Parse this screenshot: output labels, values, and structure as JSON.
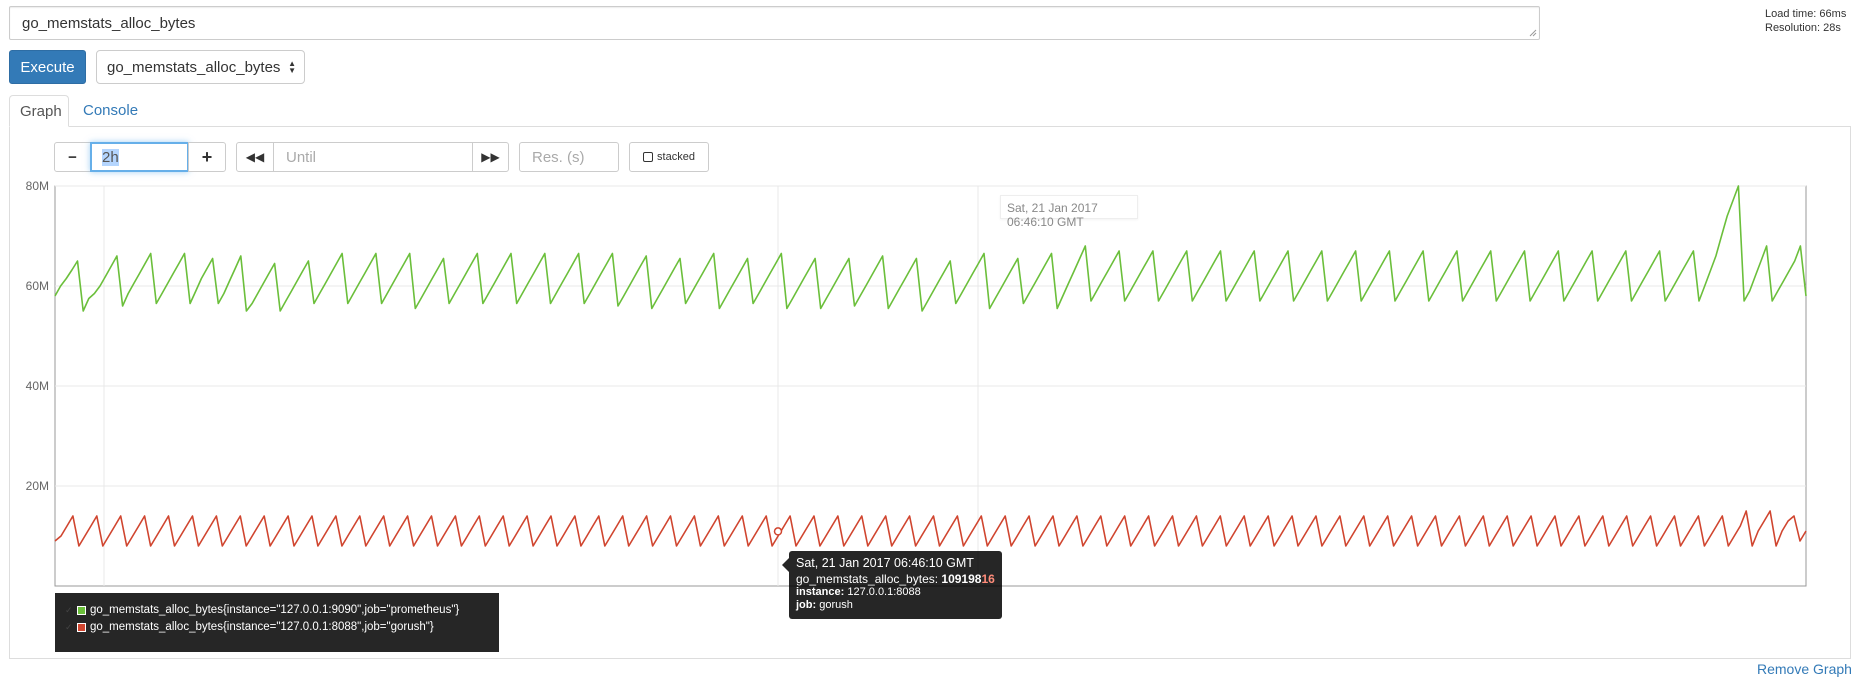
{
  "expression": {
    "value": "go_memstats_alloc_bytes"
  },
  "meta": {
    "load_time": "Load time: 66ms",
    "resolution": "Resolution: 28s"
  },
  "execute": {
    "label": "Execute"
  },
  "metric_select": {
    "selected": "go_memstats_alloc_bytes"
  },
  "tabs": [
    {
      "label": "Graph",
      "active": true
    },
    {
      "label": "Console",
      "active": false
    }
  ],
  "controls": {
    "minus": "−",
    "range": "2h",
    "plus": "+",
    "back": "◀◀",
    "until_placeholder": "Until",
    "forward": "▶▶",
    "res_placeholder": "Res. (s)",
    "stacked": "stacked"
  },
  "hover_time": "Sat, 21 Jan 2017 06:46:10 GMT",
  "tooltip": {
    "time": "Sat, 21 Jan 2017 06:46:10 GMT",
    "metric_label": "go_memstats_alloc_bytes: ",
    "value_main": "109198",
    "value_highlight": "16",
    "instance_label": "instance:",
    "instance_value": "127.0.0.1:8088",
    "job_label": "job:",
    "job_value": "gorush"
  },
  "legend": [
    {
      "label": "go_memstats_alloc_bytes{instance=\"127.0.0.1:9090\",job=\"prometheus\"}",
      "color": "#6bbf3b"
    },
    {
      "label": "go_memstats_alloc_bytes{instance=\"127.0.0.1:8088\",job=\"gorush\"}",
      "color": "#d0452f"
    }
  ],
  "remove_graph": "Remove Graph",
  "chart_data": {
    "type": "line",
    "ylim": [
      0,
      80000000
    ],
    "y_ticks": [
      "20M",
      "40M",
      "60M",
      "80M"
    ],
    "grid": true,
    "series": [
      {
        "name": "go_memstats_alloc_bytes{instance=\"127.0.0.1:9090\",job=\"prometheus\"}",
        "color": "#6bbf3b",
        "values": [
          58,
          60,
          61.5,
          63.2,
          65,
          55,
          57.5,
          58.5,
          60,
          62,
          64,
          66,
          56,
          58.5,
          60.5,
          62.5,
          64.5,
          66.5,
          56.5,
          58.5,
          60.5,
          62.5,
          64.5,
          66.5,
          56.5,
          59,
          61.5,
          63.5,
          65.5,
          56.5,
          58.5,
          61,
          63.5,
          66,
          55,
          56.5,
          58.5,
          60.5,
          62.5,
          64.5,
          55,
          57,
          59,
          61,
          63,
          65,
          56.5,
          58.5,
          60.5,
          62.5,
          64.5,
          66.5,
          56.5,
          58.5,
          60.5,
          62.5,
          64.5,
          66.5,
          56.5,
          58.5,
          60.5,
          62.5,
          64.5,
          66.5,
          55.5,
          57.5,
          59.5,
          61.5,
          63.5,
          65.5,
          56.5,
          58.5,
          60.5,
          62.5,
          64.5,
          66.5,
          56.5,
          58.5,
          60.5,
          62.5,
          64.5,
          66.5,
          56.5,
          58.5,
          60.5,
          62.5,
          64.5,
          66.5,
          56.5,
          58.5,
          60.5,
          62.5,
          64.5,
          66.5,
          56.5,
          58.5,
          60.5,
          62.5,
          64.5,
          66.5,
          56,
          58,
          60,
          62,
          64,
          66,
          55.5,
          57.5,
          59.5,
          61.5,
          63.5,
          65.5,
          56.5,
          58.5,
          60.5,
          62.5,
          64.5,
          66.5,
          55.5,
          57.5,
          59.5,
          61.5,
          63.5,
          65.5,
          56.5,
          58.5,
          60.5,
          62.5,
          64.5,
          66.5,
          55.5,
          57.5,
          59.5,
          61.5,
          63.5,
          65.5,
          55.5,
          57.5,
          59.5,
          61.5,
          63.5,
          65.5,
          56,
          58,
          60,
          62,
          64,
          66,
          55.5,
          57.5,
          59.5,
          61.5,
          63.5,
          65.5,
          55,
          57,
          59,
          61,
          63,
          65,
          56.5,
          58.5,
          60.5,
          62.5,
          64.5,
          66.5,
          55.5,
          57.5,
          59.5,
          61.5,
          63.5,
          65.5,
          56.5,
          58.5,
          60.5,
          62.5,
          64.5,
          66.5,
          55.5,
          58,
          60.5,
          63,
          65.5,
          68,
          57,
          59,
          61,
          63,
          65,
          67,
          57,
          59,
          61,
          63,
          65,
          67,
          57,
          59,
          61,
          63,
          65,
          67,
          57,
          59,
          61,
          63,
          65,
          67,
          57,
          59,
          61,
          63,
          65,
          67,
          57,
          59,
          61,
          63,
          65,
          67,
          57,
          59,
          61,
          63,
          65,
          67,
          57,
          59,
          61,
          63,
          65,
          67,
          57,
          59,
          61,
          63,
          65,
          67,
          57,
          59,
          61,
          63,
          65,
          67,
          57,
          59,
          61,
          63,
          65,
          67,
          57,
          59,
          61,
          63,
          65,
          67,
          57,
          59,
          61,
          63,
          65,
          67,
          57,
          59,
          61,
          63,
          65,
          67,
          57,
          59,
          61,
          63,
          65,
          67,
          57,
          59,
          61,
          63,
          65,
          67,
          57,
          59,
          61,
          63,
          65,
          67,
          57,
          59,
          61,
          63,
          65,
          67,
          57,
          60,
          63,
          66,
          70,
          74,
          77,
          80,
          57,
          59,
          62,
          65,
          68,
          57,
          59,
          61,
          63,
          65,
          68,
          58
        ]
      },
      {
        "name": "go_memstats_alloc_bytes{instance=\"127.0.0.1:8088\",job=\"gorush\"}",
        "color": "#d0452f",
        "values": [
          9,
          10,
          12,
          14,
          8,
          10,
          12,
          14,
          8,
          10,
          12,
          14,
          8,
          10,
          12,
          14,
          8,
          10,
          12,
          14,
          8,
          10,
          12,
          14,
          8,
          10,
          12,
          14,
          8,
          10,
          12,
          14,
          8,
          10,
          12,
          14,
          8,
          10,
          12,
          14,
          8,
          10,
          12,
          14,
          8,
          10,
          12,
          14,
          8,
          10,
          12,
          14,
          8,
          10,
          12,
          14,
          8,
          10,
          12,
          14,
          8,
          10,
          12,
          14,
          8,
          10,
          12,
          14,
          8,
          10,
          12,
          14,
          8,
          10,
          12,
          14,
          8,
          10,
          12,
          14,
          8,
          10,
          12,
          14,
          8,
          10,
          12,
          14,
          8,
          10,
          12,
          14,
          8,
          10,
          12,
          14,
          8,
          10,
          12,
          14,
          8,
          10,
          12,
          14,
          8,
          10,
          12,
          14,
          8,
          10,
          12,
          14,
          8,
          10,
          12,
          14,
          8,
          10,
          12,
          14,
          8,
          10,
          12,
          14,
          8,
          10,
          12,
          14,
          8,
          10,
          12,
          14,
          8,
          10,
          12,
          14,
          8,
          10,
          12,
          14,
          8,
          10,
          12,
          14,
          8,
          10,
          12,
          14,
          8,
          10,
          12,
          14,
          8,
          10,
          12,
          14,
          8,
          10,
          12,
          14,
          8,
          10,
          12,
          14,
          8,
          10,
          12,
          14,
          8,
          10,
          12,
          14,
          8,
          10,
          12,
          14,
          8,
          10,
          12,
          14,
          8,
          10,
          12,
          14,
          8,
          10,
          12,
          14,
          8,
          10,
          12,
          14,
          8,
          10,
          12,
          14,
          8,
          10,
          12,
          14,
          8,
          10,
          12,
          14,
          8,
          10,
          12,
          14,
          8,
          10,
          12,
          14,
          8,
          10,
          12,
          14,
          8,
          10,
          12,
          14,
          8,
          10,
          12,
          14,
          8,
          10,
          12,
          14,
          8,
          10,
          12,
          14,
          8,
          10,
          12,
          14,
          8,
          10,
          12,
          14,
          8,
          10,
          12,
          14,
          8,
          10,
          12,
          14,
          8,
          10,
          12,
          14,
          8,
          10,
          12,
          14,
          8,
          10,
          12,
          14,
          8,
          10,
          12,
          14,
          8,
          10,
          12,
          14,
          8,
          10,
          12,
          14,
          8,
          10,
          12,
          14,
          8,
          10,
          12,
          14,
          8,
          10,
          12,
          15,
          8,
          11,
          13,
          15,
          8,
          11,
          13,
          14,
          9,
          11
        ]
      }
    ]
  }
}
